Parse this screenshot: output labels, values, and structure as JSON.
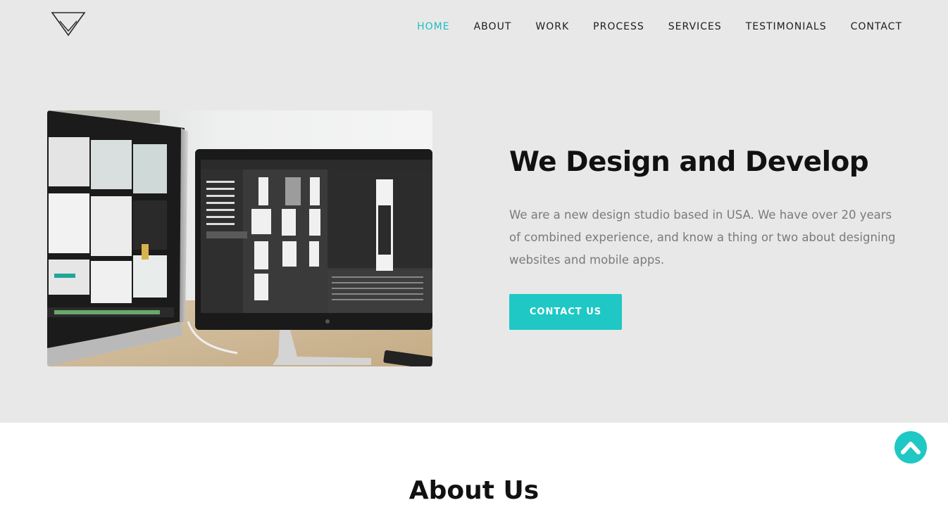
{
  "nav": {
    "items": [
      {
        "label": "HOME",
        "active": true
      },
      {
        "label": "ABOUT"
      },
      {
        "label": "WORK"
      },
      {
        "label": "PROCESS"
      },
      {
        "label": "SERVICES"
      },
      {
        "label": "TESTIMONIALS"
      },
      {
        "label": "CONTACT"
      }
    ]
  },
  "logo": {
    "icon": "triangle-logo-icon"
  },
  "hero": {
    "title": "We Design and Develop",
    "text": "We are a new design studio based in USA. We have over 20 years of combined experience, and know a thing or two about designing websites and mobile apps.",
    "cta_label": "CONTACT US",
    "image_icon": "desk-monitors-photo"
  },
  "about": {
    "heading": "About Us"
  },
  "scroll_top": {
    "icon": "chevron-up-icon"
  },
  "colors": {
    "accent": "#1fc8c4",
    "hero_bg": "#e8e8e8",
    "text_dark": "#111111",
    "text_muted": "#7a7a7a"
  }
}
